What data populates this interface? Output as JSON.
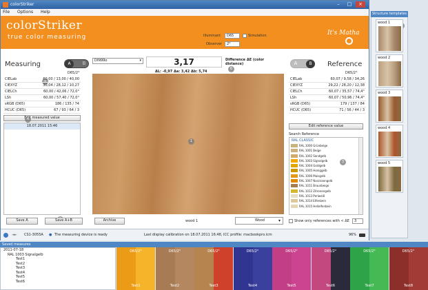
{
  "window": {
    "title": "colorStriker"
  },
  "menu": [
    "File",
    "Options",
    "Help"
  ],
  "header": {
    "brand": "colorStriker",
    "brand_sub": "true color measuring",
    "illuminant_label": "Illuminant",
    "illuminant_value": "D65",
    "simulation_label": "Simulation",
    "observer_label": "Observer",
    "observer_value": "2°",
    "logo_text": "It's Matha"
  },
  "measuring": {
    "title": "Measuring",
    "toggle_a": "A",
    "toggle_b": "B",
    "condition": "D65/2°",
    "rows": [
      {
        "k": "CIELab",
        "v": "60,00 / 13,00 / 40,00"
      },
      {
        "k": "CIEXYZ",
        "v": "30,04 / 28,12 / 10,27"
      },
      {
        "k": "CIELCh",
        "v": "60,00 / 42,06 / 72,0°"
      },
      {
        "k": "LSh",
        "v": "60,00 / 57,40 / 72,0°"
      },
      {
        "k": "sRGB (D65)",
        "v": "186 / 135 / 74"
      },
      {
        "k": "HCUC (D65)",
        "v": "67 / 93 / 64 / 3"
      }
    ],
    "edit_button": "Edit measured value",
    "entry": "18.07.2011 15:46",
    "save_a": "Save A",
    "save_ab": "Save A+B"
  },
  "center": {
    "illum_select": "DIN99o",
    "delta_value": "3,17",
    "delta_title": "Difference ΔE (color distance)",
    "delta_detail": "ΔL: -0,97  Δa: 3,42  Δb: 5,74",
    "archive_button": "Archive",
    "wood_label": "wood 1",
    "wood_select": "Wood"
  },
  "reference": {
    "title": "Reference",
    "toggle_a": "A",
    "toggle_b": "B",
    "condition": "D65/2°",
    "rows": [
      {
        "k": "CIELab",
        "v": "60,07 / 9,58 / 34,26"
      },
      {
        "k": "CIEXYZ",
        "v": "29,22 / 28,20 / 12,38"
      },
      {
        "k": "CIELCh",
        "v": "60,07 / 35,57 / 74,4°"
      },
      {
        "k": "LSh",
        "v": "60,07 / 50,96 / 74,4°"
      },
      {
        "k": "sRGB (D65)",
        "v": "179 / 137 / 84"
      },
      {
        "k": "HCUC (D65)",
        "v": "71 / 56 / 44 / 3"
      }
    ],
    "edit_button": "Edit reference value",
    "search_label": "Search Reference",
    "group": "RAL CLASSIC",
    "items": [
      {
        "name": "RAL 1000 Grünbeige",
        "c": "#c9b37d"
      },
      {
        "name": "RAL 1001 Beige",
        "c": "#cdb182"
      },
      {
        "name": "RAL 1002 Sandgelb",
        "c": "#d0ab6c"
      },
      {
        "name": "RAL 1003 Signalgelb",
        "c": "#f4a900"
      },
      {
        "name": "RAL 1004 Goldgelb",
        "c": "#e1a600"
      },
      {
        "name": "RAL 1005 Honiggelb",
        "c": "#cb9a00"
      },
      {
        "name": "RAL 1006 Maisgelb",
        "c": "#e39a1a"
      },
      {
        "name": "RAL 1007 Narzissengelb",
        "c": "#e08a00"
      },
      {
        "name": "RAL 1011 Braunbeige",
        "c": "#a67d50"
      },
      {
        "name": "RAL 1012 Zitronengelb",
        "c": "#d3b72c"
      },
      {
        "name": "RAL 1013 Perlweiß",
        "c": "#e6dfc8"
      },
      {
        "name": "RAL 1014 Elfenbein",
        "c": "#ddc79b"
      },
      {
        "name": "RAL 1015 Hellelfenbein",
        "c": "#e6d7b4"
      }
    ],
    "show_only": "Show only references with < ΔE",
    "threshold": "3"
  },
  "status": {
    "device": "CS1-3055A",
    "message": "The measuring device is ready",
    "calibration": "Last display calibration on 18.07.2011 16:48, ICC profile: macbookpro.icm",
    "zoom": "96%"
  },
  "templates": {
    "title": "Structure templates",
    "items": [
      {
        "label": "wood 1",
        "c": "#a7896a"
      },
      {
        "label": "wood 2",
        "c": "#b99f80"
      },
      {
        "label": "wood 3",
        "c": "#9a5a2e"
      },
      {
        "label": "wood 4",
        "c": "#b0552a"
      },
      {
        "label": "wood 5",
        "c": "#7c6a3e"
      }
    ]
  },
  "saved": {
    "title": "Saved measures",
    "tree": [
      "2011-07-18",
      "RAL 1003 Signalgelb",
      "Test1",
      "Test2",
      "Test3",
      "Test4",
      "Test5",
      "Test6"
    ],
    "pairs": [
      {
        "a": "#ec9b17",
        "b": "#f6b42a",
        "label": "D65/2°",
        "name": "Test1"
      },
      {
        "a": "#a77c55",
        "b": "#b48761",
        "label": "D65/2°",
        "name": "Test2"
      },
      {
        "a": "#b6854f",
        "b": "#d0412b",
        "label": "D65/2°",
        "name": "Test3"
      },
      {
        "a": "#2f3590",
        "b": "#39409e",
        "label": "D65/2°",
        "name": "Test4"
      },
      {
        "a": "#c23f86",
        "b": "#cc4390",
        "label": "D65/2°",
        "name": "Test5"
      },
      {
        "a": "#c2487f",
        "b": "#2a2a3a",
        "label": "D65/2°",
        "name": "Test6"
      },
      {
        "a": "#2ea347",
        "b": "#45b953",
        "label": "D65/2°",
        "name": "Test7"
      },
      {
        "a": "#8c2f2a",
        "b": "#a23a35",
        "label": "D65/2°",
        "name": "Test8"
      }
    ]
  },
  "markers": [
    "1",
    "2",
    "3",
    "4",
    "5",
    "6",
    "7"
  ]
}
